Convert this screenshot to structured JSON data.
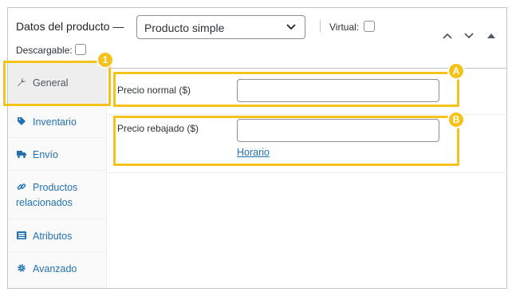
{
  "header": {
    "title": "Datos del producto —",
    "product_type": {
      "selected": "Producto simple"
    },
    "virtual_label": "Virtual:",
    "downloadable_label": "Descargable:"
  },
  "sidebar": {
    "items": [
      {
        "label": "General",
        "icon": "wrench-icon"
      },
      {
        "label": "Inventario",
        "icon": "tag-icon"
      },
      {
        "label": "Envío",
        "icon": "truck-icon"
      },
      {
        "label": "Productos relacionados",
        "icon": "link-icon"
      },
      {
        "label": "Atributos",
        "icon": "list-icon"
      },
      {
        "label": "Avanzado",
        "icon": "gear-icon"
      }
    ]
  },
  "general": {
    "regular_price_label": "Precio normal ($)",
    "regular_price_value": "",
    "sale_price_label": "Precio rebajado ($)",
    "sale_price_value": "",
    "schedule_link": "Horario"
  },
  "annotations": {
    "badge_1": "1",
    "badge_a": "A",
    "badge_b": "B"
  },
  "colors": {
    "highlight": "#f5c21b",
    "link": "#2271b1",
    "border": "#c3c4c7"
  }
}
